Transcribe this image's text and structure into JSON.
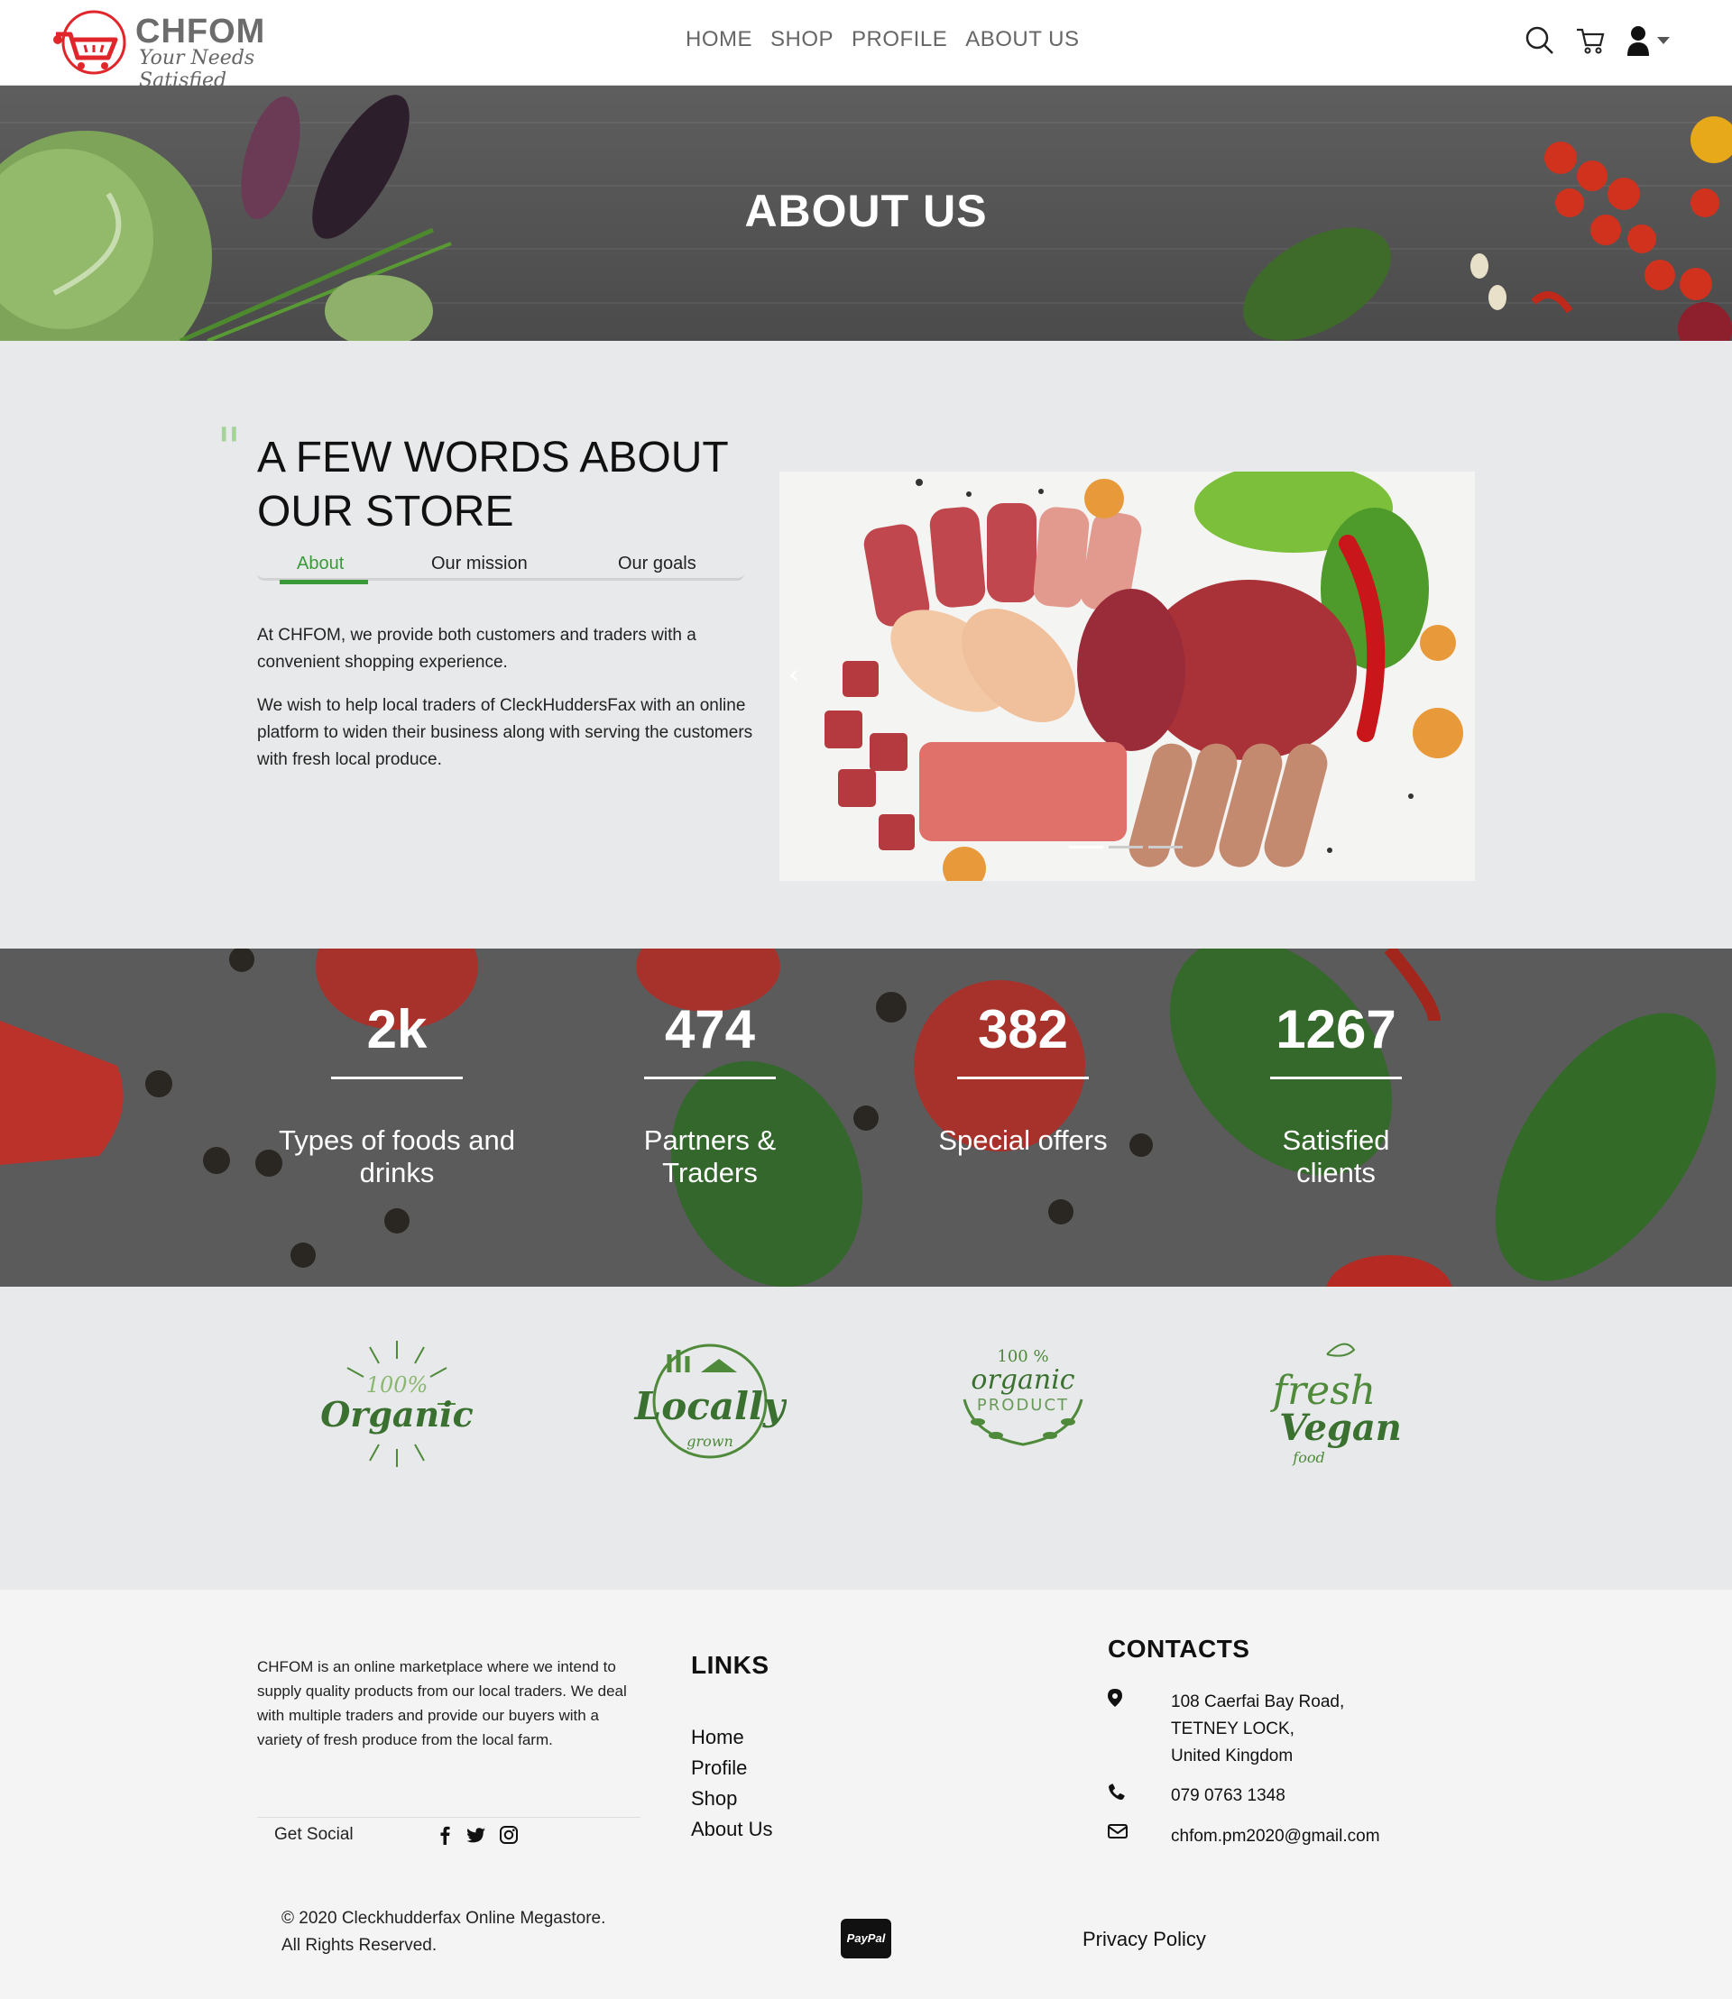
{
  "header": {
    "logo_name": "CHFOM",
    "logo_tagline": "Your Needs Satisfied",
    "nav": [
      "HOME",
      "SHOP",
      "PROFILE",
      "ABOUT US"
    ],
    "icons": [
      "search-icon",
      "cart-icon",
      "user-icon",
      "caret-down-icon"
    ]
  },
  "banner": {
    "title": "ABOUT US"
  },
  "about": {
    "heading": "A FEW WORDS ABOUT OUR STORE",
    "tabs": [
      "About",
      "Our mission",
      "Our goals"
    ],
    "active_tab": "About",
    "paragraphs": [
      "At CHFOM, we provide both customers and traders with a convenient shopping experience.",
      "We wish to help local traders of CleckHuddersFax with an online platform to widen their business along with serving the customers with fresh local produce."
    ],
    "carousel": {
      "image": "meat-assortment",
      "slides": 3,
      "active_slide": 1
    }
  },
  "stats": [
    {
      "value": "2k",
      "label": "Types of foods and drinks"
    },
    {
      "value": "474",
      "label": "Partners & Traders"
    },
    {
      "value": "382",
      "label": "Special offers"
    },
    {
      "value": "1267",
      "label": "Satisfied clients"
    }
  ],
  "badges": [
    {
      "name": "100% Organic",
      "icon": "organic-badge-icon"
    },
    {
      "name": "Locally grown",
      "icon": "locally-grown-badge-icon"
    },
    {
      "name": "100% organic product",
      "icon": "organic-product-badge-icon"
    },
    {
      "name": "fresh Vegan food",
      "icon": "fresh-vegan-badge-icon"
    }
  ],
  "footer": {
    "description": "CHFOM is an online marketplace where we intend to supply quality products from our local traders. We deal with multiple traders and provide our buyers with a variety of fresh produce from the local farm.",
    "get_social": "Get Social",
    "social_icons": [
      "facebook-icon",
      "twitter-icon",
      "instagram-icon"
    ],
    "links_heading": "LINKS",
    "links": [
      "Home",
      "Profile",
      "Shop",
      "About Us"
    ],
    "contacts_heading": "CONTACTS",
    "address": [
      "108 Caerfai Bay Road,",
      "TETNEY LOCK,",
      "United Kingdom"
    ],
    "phone": "079 0763 1348",
    "email": "chfom.pm2020@gmail.com",
    "copyright": "© 2020 Cleckhudderfax Online Megastore. All Rights Reserved.",
    "payment": "PayPal",
    "privacy": "Privacy Policy"
  },
  "colors": {
    "accent": "#3a9a3a",
    "logo_red": "#e0262b",
    "banner": "#555555",
    "stats_bg": "#5b5b5c",
    "section_bg": "#e8e9ea"
  }
}
